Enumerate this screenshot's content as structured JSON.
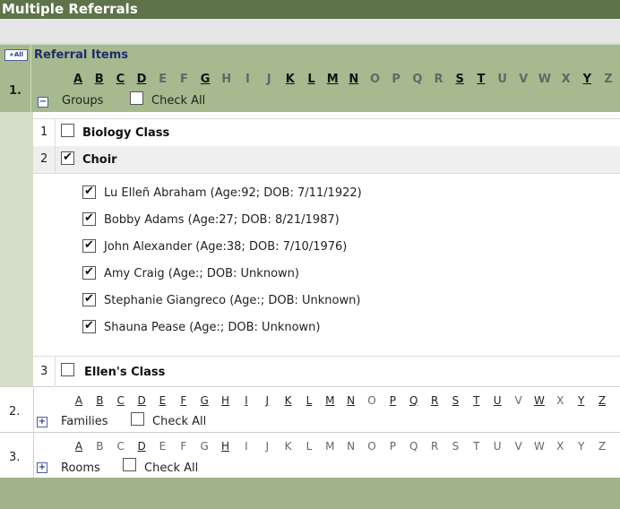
{
  "title": "Multiple Referrals",
  "add_all_label": "+All",
  "referral_items_label": "Referral Items",
  "alphabet": [
    "A",
    "B",
    "C",
    "D",
    "E",
    "F",
    "G",
    "H",
    "I",
    "J",
    "K",
    "L",
    "M",
    "N",
    "O",
    "P",
    "Q",
    "R",
    "S",
    "T",
    "U",
    "V",
    "W",
    "X",
    "Y",
    "Z"
  ],
  "check_all_label": "Check All",
  "sections": [
    {
      "number": "1.",
      "name": "Groups",
      "toggle": "−",
      "linked_letters": [
        "A",
        "B",
        "C",
        "D",
        "G",
        "K",
        "L",
        "M",
        "N",
        "S",
        "T",
        "Y"
      ],
      "groups": [
        {
          "num": "1",
          "name": "Biology Class",
          "checked": false
        },
        {
          "num": "2",
          "name": "Choir",
          "checked": true,
          "members": [
            {
              "text": "Lu Elleñ Abraham (Age:92; DOB: 7/11/1922)",
              "checked": true
            },
            {
              "text": "Bobby Adams (Age:27; DOB: 8/21/1987)",
              "checked": true
            },
            {
              "text": "John Alexander (Age:38; DOB: 7/10/1976)",
              "checked": true
            },
            {
              "text": "Amy Craig (Age:; DOB: Unknown)",
              "checked": true
            },
            {
              "text": "Stephanie Giangreco (Age:; DOB: Unknown)",
              "checked": true
            },
            {
              "text": "Shauna Pease (Age:; DOB: Unknown)",
              "checked": true
            }
          ]
        },
        {
          "num": "3",
          "name": "Ellen's Class",
          "checked": false
        }
      ]
    },
    {
      "number": "2.",
      "name": "Families",
      "toggle": "+",
      "linked_letters": [
        "A",
        "B",
        "C",
        "D",
        "E",
        "F",
        "G",
        "H",
        "I",
        "J",
        "K",
        "L",
        "M",
        "N",
        "P",
        "Q",
        "R",
        "S",
        "T",
        "U",
        "W",
        "Y",
        "Z"
      ]
    },
    {
      "number": "3.",
      "name": "Rooms",
      "toggle": "+",
      "linked_letters": [
        "A",
        "D",
        "H"
      ]
    }
  ]
}
